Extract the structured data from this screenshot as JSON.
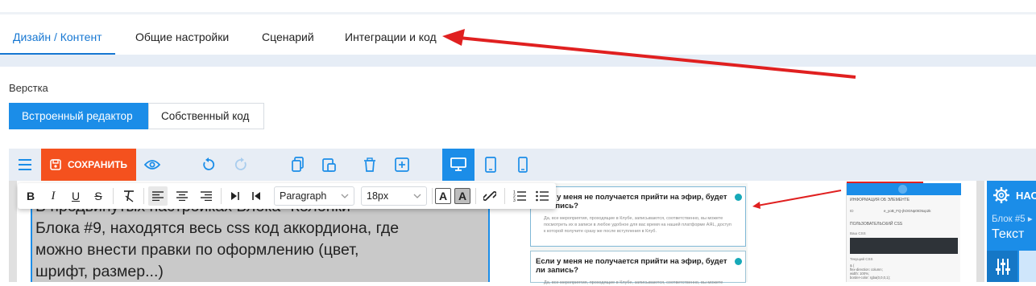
{
  "tabs": {
    "design": "Дизайн / Контент",
    "general": "Общие настройки",
    "scenario": "Сценарий",
    "integrations": "Интеграции и код"
  },
  "layout": {
    "label": "Верстка",
    "builtin_editor": "Встроенный редактор",
    "own_code": "Собственный код"
  },
  "toolbar": {
    "save_label": "СОХРАНИТЬ"
  },
  "rte": {
    "paragraph": "Paragraph",
    "font_size": "18px"
  },
  "content": {
    "line1": "В продвинутых настройках Блока \"Колонки\"",
    "line2": "Блока #9, находятся весь css код аккордиона, где",
    "line3": "можно внести правки по оформлению (цвет,",
    "line4": "шрифт, размер...)"
  },
  "preview": {
    "q1": "Если у меня не получается прийти на эфир, будет ли запись?",
    "a1": "Да, все мероприятия, проходящие в Клубе, записываются, соответственно, вы можете посмотреть их в записи в любое удобное для вас время на нашей платформе АЯL, доступ к которой получите сразу же после вступления в Клуб.",
    "q2": "Если у меня не получается прийти на эфир, будет ли запись?",
    "a2": "Да, все мероприятия, проходящие в Клубе, записываются, соответственно, вы можете"
  },
  "inspector": {
    "info": "ИНФОРМАЦИЯ ОБ ЭЛЕМЕНТЕ",
    "id_label": "ID",
    "id_value": "e_yoB_FQ-jhOGNp0tO5xp2k",
    "custom_css": "ПОЛЬЗОВАТЕЛЬСКИЙ CSS",
    "your_css": "Ваш CSS",
    "current_css": "Текущий CSS",
    "css_line1": "& {",
    "css_line2": "  flex-direction: column;",
    "css_line3": "  width: 100%;",
    "css_line4": "  border-color: rgba(0,0,0,1);"
  },
  "right_panel": {
    "title": "НАС",
    "block": "Блок #5 ▸",
    "text": "Текст"
  },
  "colors": {
    "accent": "#1b8de8",
    "save": "#f4511e",
    "arrow": "#e02020"
  }
}
